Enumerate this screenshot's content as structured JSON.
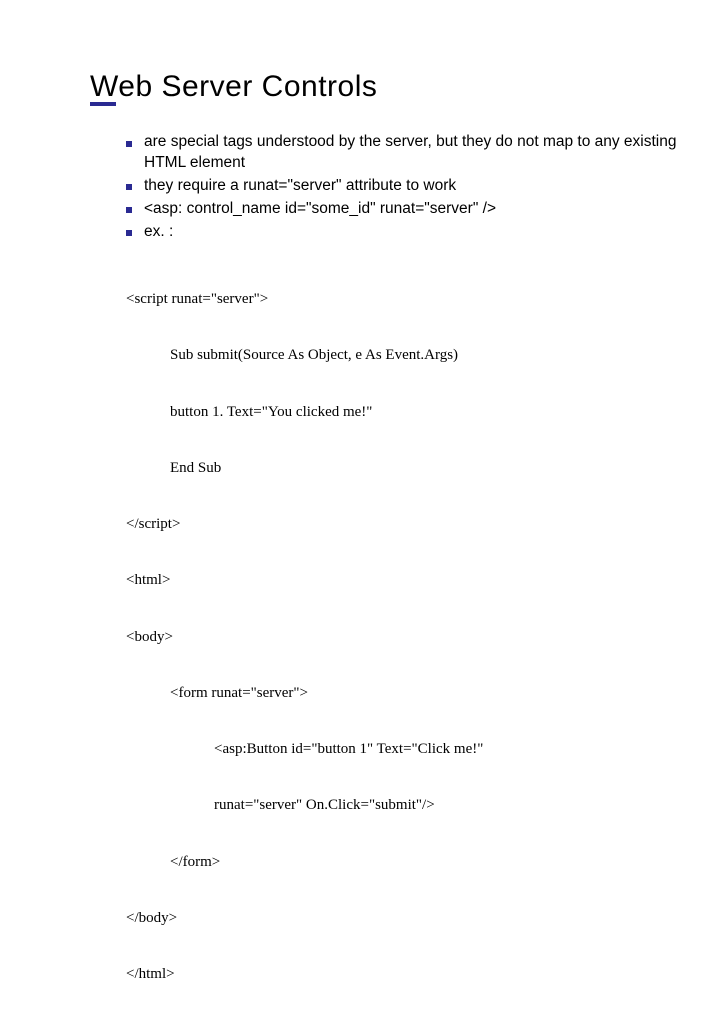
{
  "title": "Web Server Controls",
  "bullets": [
    "are special tags understood by the server, but they do not map to any existing HTML element",
    "they require a runat=\"server\" attribute to work",
    "<asp: control_name id=\"some_id\" runat=\"server\" />",
    "ex. :"
  ],
  "code_lines": [
    {
      "text": "<script runat=\"server\">",
      "indent": 0
    },
    {
      "text": "Sub submit(Source As Object, e As Event.Args)",
      "indent": 1
    },
    {
      "text": "button 1. Text=\"You clicked me!\"",
      "indent": 1
    },
    {
      "text": "End Sub",
      "indent": 1
    },
    {
      "text": "</script>",
      "indent": 0
    },
    {
      "text": "<html>",
      "indent": 0
    },
    {
      "text": "<body>",
      "indent": 0
    },
    {
      "text": "<form runat=\"server\">",
      "indent": 1
    },
    {
      "text": "<asp:Button id=\"button 1\" Text=\"Click me!\"",
      "indent": 2
    },
    {
      "text": "runat=\"server\" On.Click=\"submit\"/>",
      "indent": 2
    },
    {
      "text": "</form>",
      "indent": 1
    },
    {
      "text": "</body>",
      "indent": 0
    },
    {
      "text": "</html>",
      "indent": 0
    }
  ]
}
